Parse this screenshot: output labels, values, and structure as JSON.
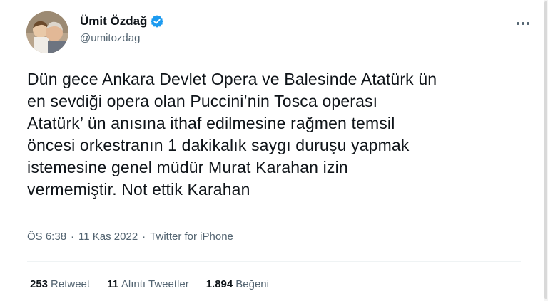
{
  "author": {
    "display_name": "Ümit Özdağ",
    "handle": "@umitozdag"
  },
  "tweet": {
    "text": "Dün gece Ankara Devlet Opera ve Balesinde Atatürk ün\nen sevdiği opera olan Puccini’nin Tosca operası\nAtatürk’ ün anısına ithaf edilmesine rağmen temsil\nöncesi orkestranın 1 dakikalık saygı duruşu yapmak\nistemesine genel müdür Murat Karahan izin\nvermemiştir. Not ettik Karahan"
  },
  "meta": {
    "time": "ÖS 6:38",
    "separator1": "·",
    "date": "11 Kas 2022",
    "separator2": "·",
    "source": "Twitter for iPhone"
  },
  "stats": {
    "retweets_count": "253",
    "retweets_label": "Retweet",
    "quotes_count": "11",
    "quotes_label": "Alıntı Tweetler",
    "likes_count": "1.894",
    "likes_label": "Beğeni"
  },
  "colors": {
    "verified_badge": "#1d9bf0",
    "secondary_text": "#536471",
    "primary_text": "#0f1419"
  }
}
